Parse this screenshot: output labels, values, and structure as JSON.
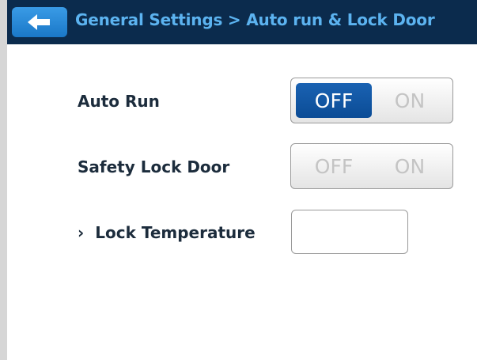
{
  "header": {
    "back_icon": "arrow-left-icon",
    "title": "General Settings > Auto run & Lock Door"
  },
  "settings": {
    "auto_run": {
      "label": "Auto Run",
      "off_label": "OFF",
      "on_label": "ON",
      "selected": "OFF"
    },
    "safety_lock_door": {
      "label": "Safety Lock Door",
      "off_label": "OFF",
      "on_label": "ON",
      "selected": "none"
    },
    "lock_temperature": {
      "chevron": "›",
      "label": "Lock Temperature",
      "value": ""
    }
  },
  "colors": {
    "header_bg": "#0b2b4d",
    "header_text": "#5cb3f0",
    "back_button": "#2a8ad8",
    "toggle_active": "#0b4c96",
    "toggle_inactive_text": "#c4c4c4"
  }
}
